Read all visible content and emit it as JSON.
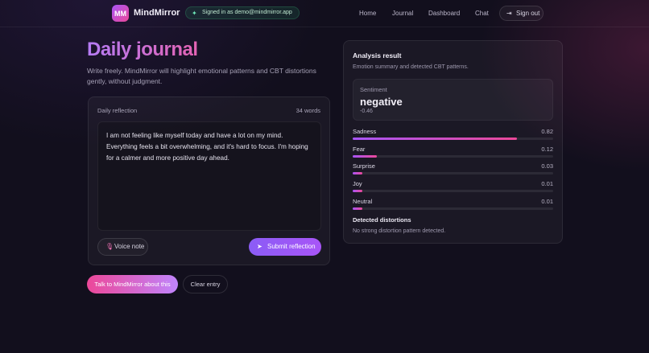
{
  "nav": {
    "logo": "MM",
    "brand": "MindMirror",
    "signed_in": "Signed in as demo@mindmirror.app",
    "links": [
      "Home",
      "Journal",
      "Dashboard",
      "Chat"
    ],
    "signout": "Sign out"
  },
  "header": {
    "title": "Daily journal",
    "subtitle": "Write freely. MindMirror will highlight emotional patterns and CBT distortions gently, without judgment."
  },
  "journal": {
    "label": "Daily reflection",
    "word_count": "34 words",
    "text": "I am not feeling like myself today and have a lot on my mind. Everything feels a bit overwhelming, and it's hard to focus. I'm hoping for a calmer and more positive day ahead.",
    "voice_label": "Voice note",
    "submit_label": "Submit reflection"
  },
  "actions": {
    "talk": "Talk to MindMirror about this",
    "clear": "Clear entry"
  },
  "analysis": {
    "title": "Analysis result",
    "subtitle": "Emotion summary and detected CBT patterns.",
    "sentiment_label": "Sentiment",
    "sentiment_value": "negative",
    "sentiment_score": "-0.46",
    "emotions": [
      {
        "name": "Sadness",
        "value": "0.82",
        "score": 0.82
      },
      {
        "name": "Fear",
        "value": "0.12",
        "score": 0.12
      },
      {
        "name": "Surprise",
        "value": "0.03",
        "score": 0.03
      },
      {
        "name": "Joy",
        "value": "0.01",
        "score": 0.01
      },
      {
        "name": "Neutral",
        "value": "0.01",
        "score": 0.01
      }
    ],
    "distortions_title": "Detected distortions",
    "distortions_text": "No strong distortion pattern detected."
  },
  "colors": {
    "accent": "#a855f7",
    "accent_pink": "#ec4899",
    "background": "#120f1d"
  },
  "icons": {
    "signed": "sparkle-icon",
    "signout": "sign-out-icon",
    "voice": "microphone-icon",
    "submit": "send-icon"
  }
}
